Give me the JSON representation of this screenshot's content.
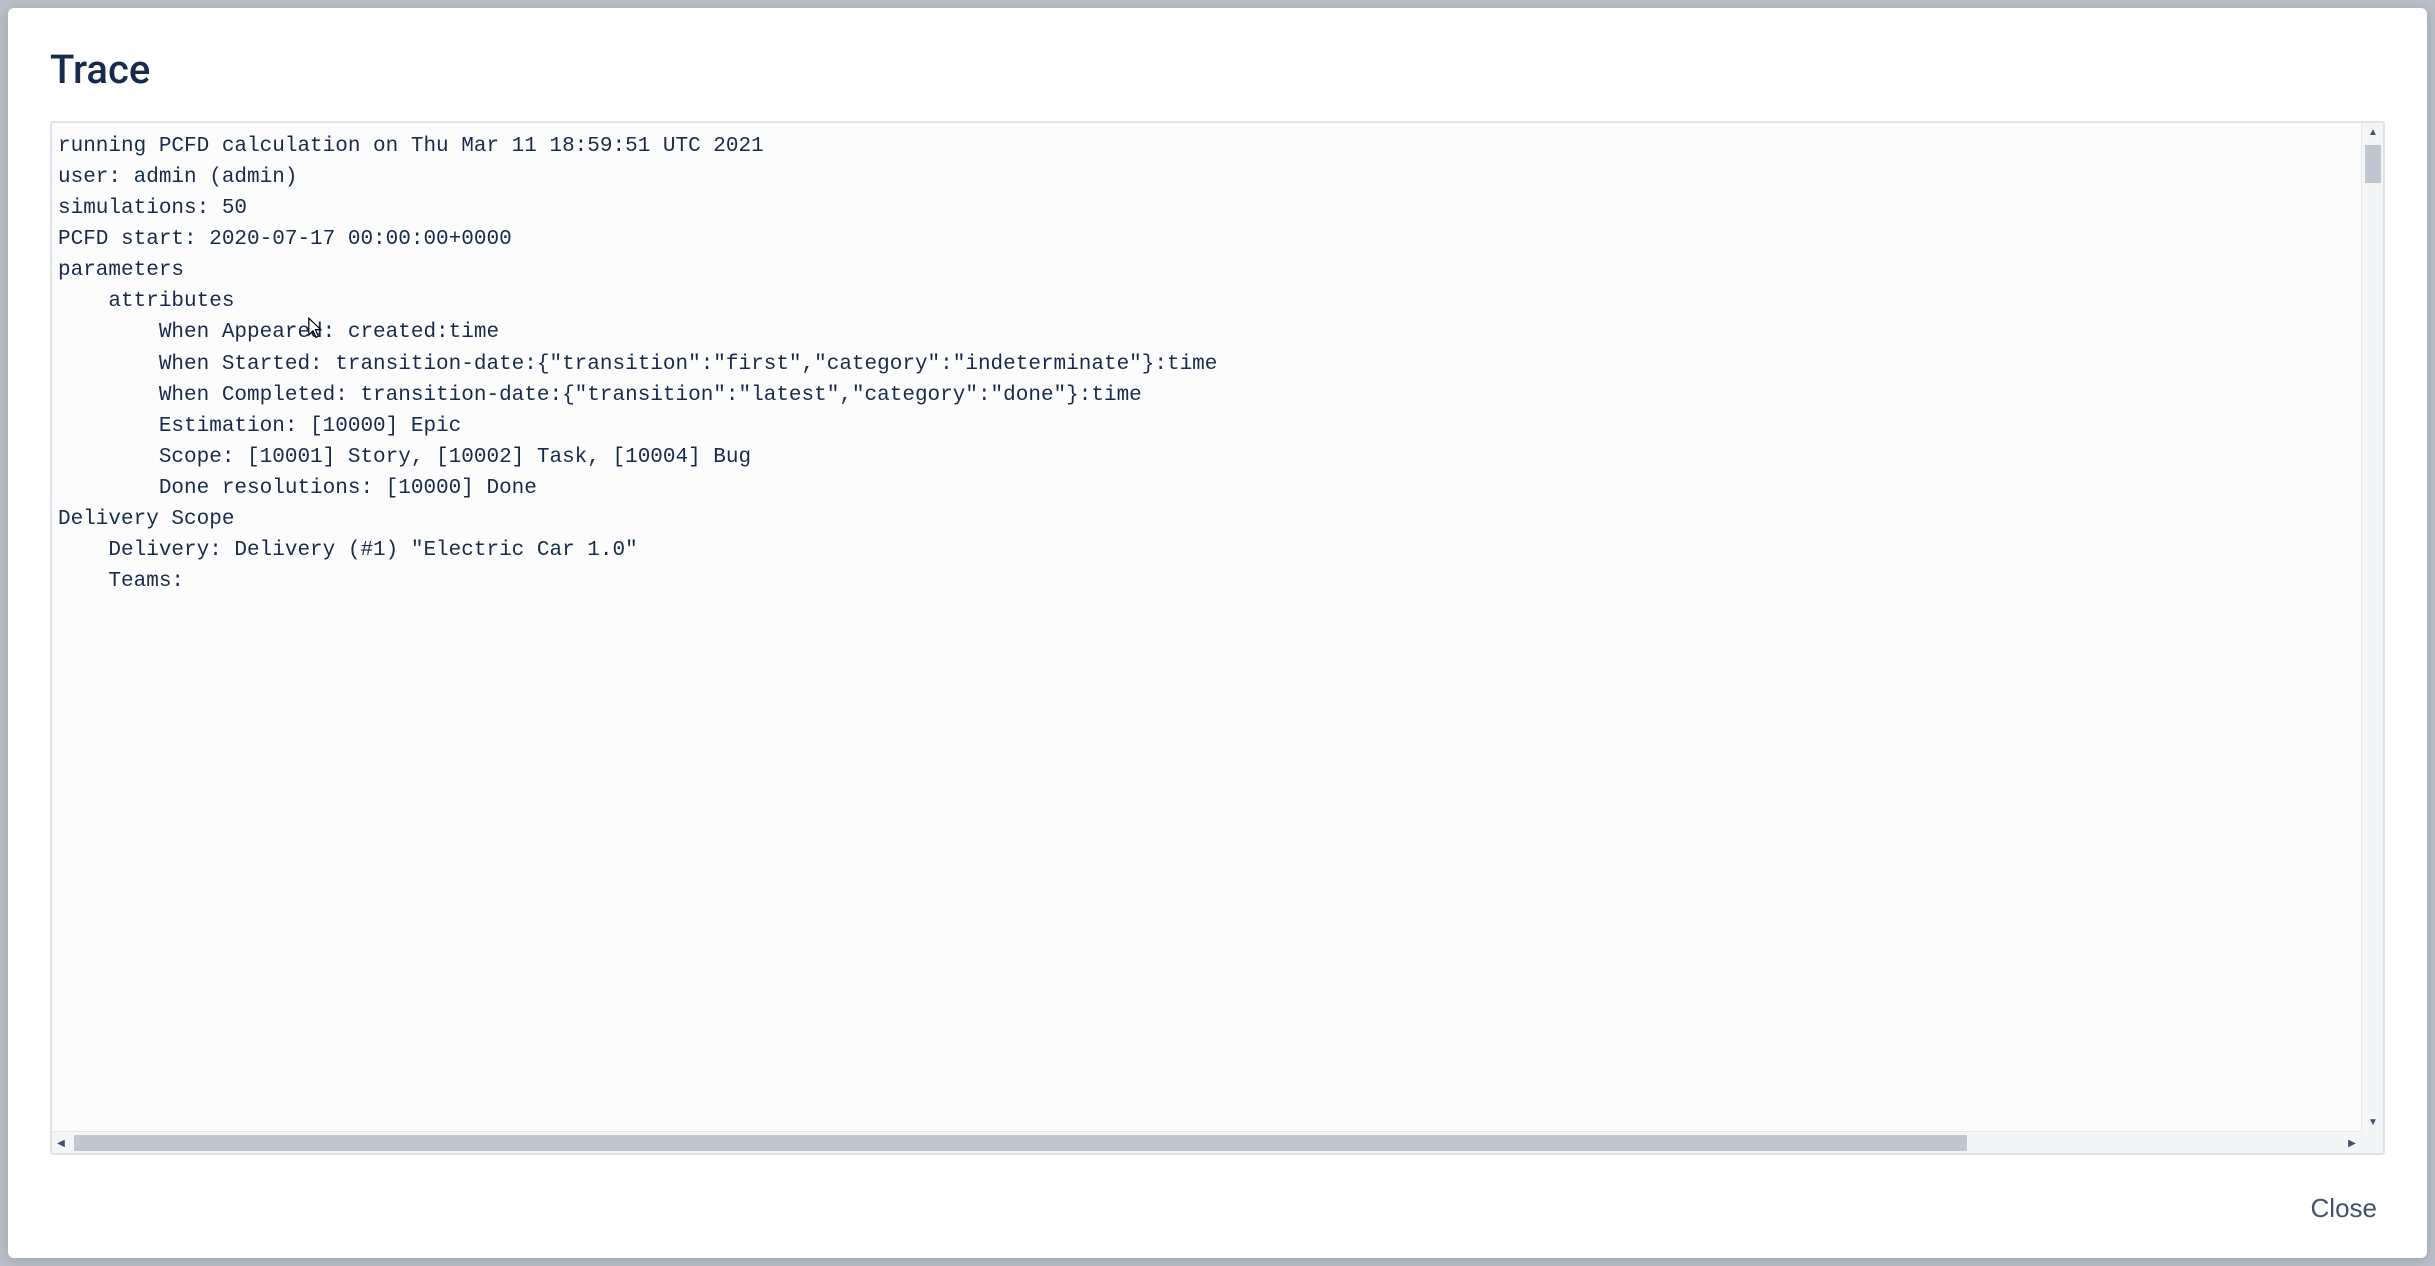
{
  "modal": {
    "title": "Trace",
    "close_label": "Close"
  },
  "trace": {
    "lines": [
      "running PCFD calculation on Thu Mar 11 18:59:51 UTC 2021",
      "user: admin (admin)",
      "simulations: 50",
      "PCFD start: 2020-07-17 00:00:00+0000",
      "parameters",
      "    attributes",
      "        When Appeared: created:time",
      "        When Started: transition-date:{\"transition\":\"first\",\"category\":\"indeterminate\"}:time",
      "        When Completed: transition-date:{\"transition\":\"latest\",\"category\":\"done\"}:time",
      "        Estimation: [10000] Epic",
      "        Scope: [10001] Story, [10002] Task, [10004] Bug",
      "        Done resolutions: [10000] Done",
      "Delivery Scope",
      "    Delivery: Delivery (#1) \"Electric Car 1.0\"",
      "    Teams:"
    ]
  }
}
